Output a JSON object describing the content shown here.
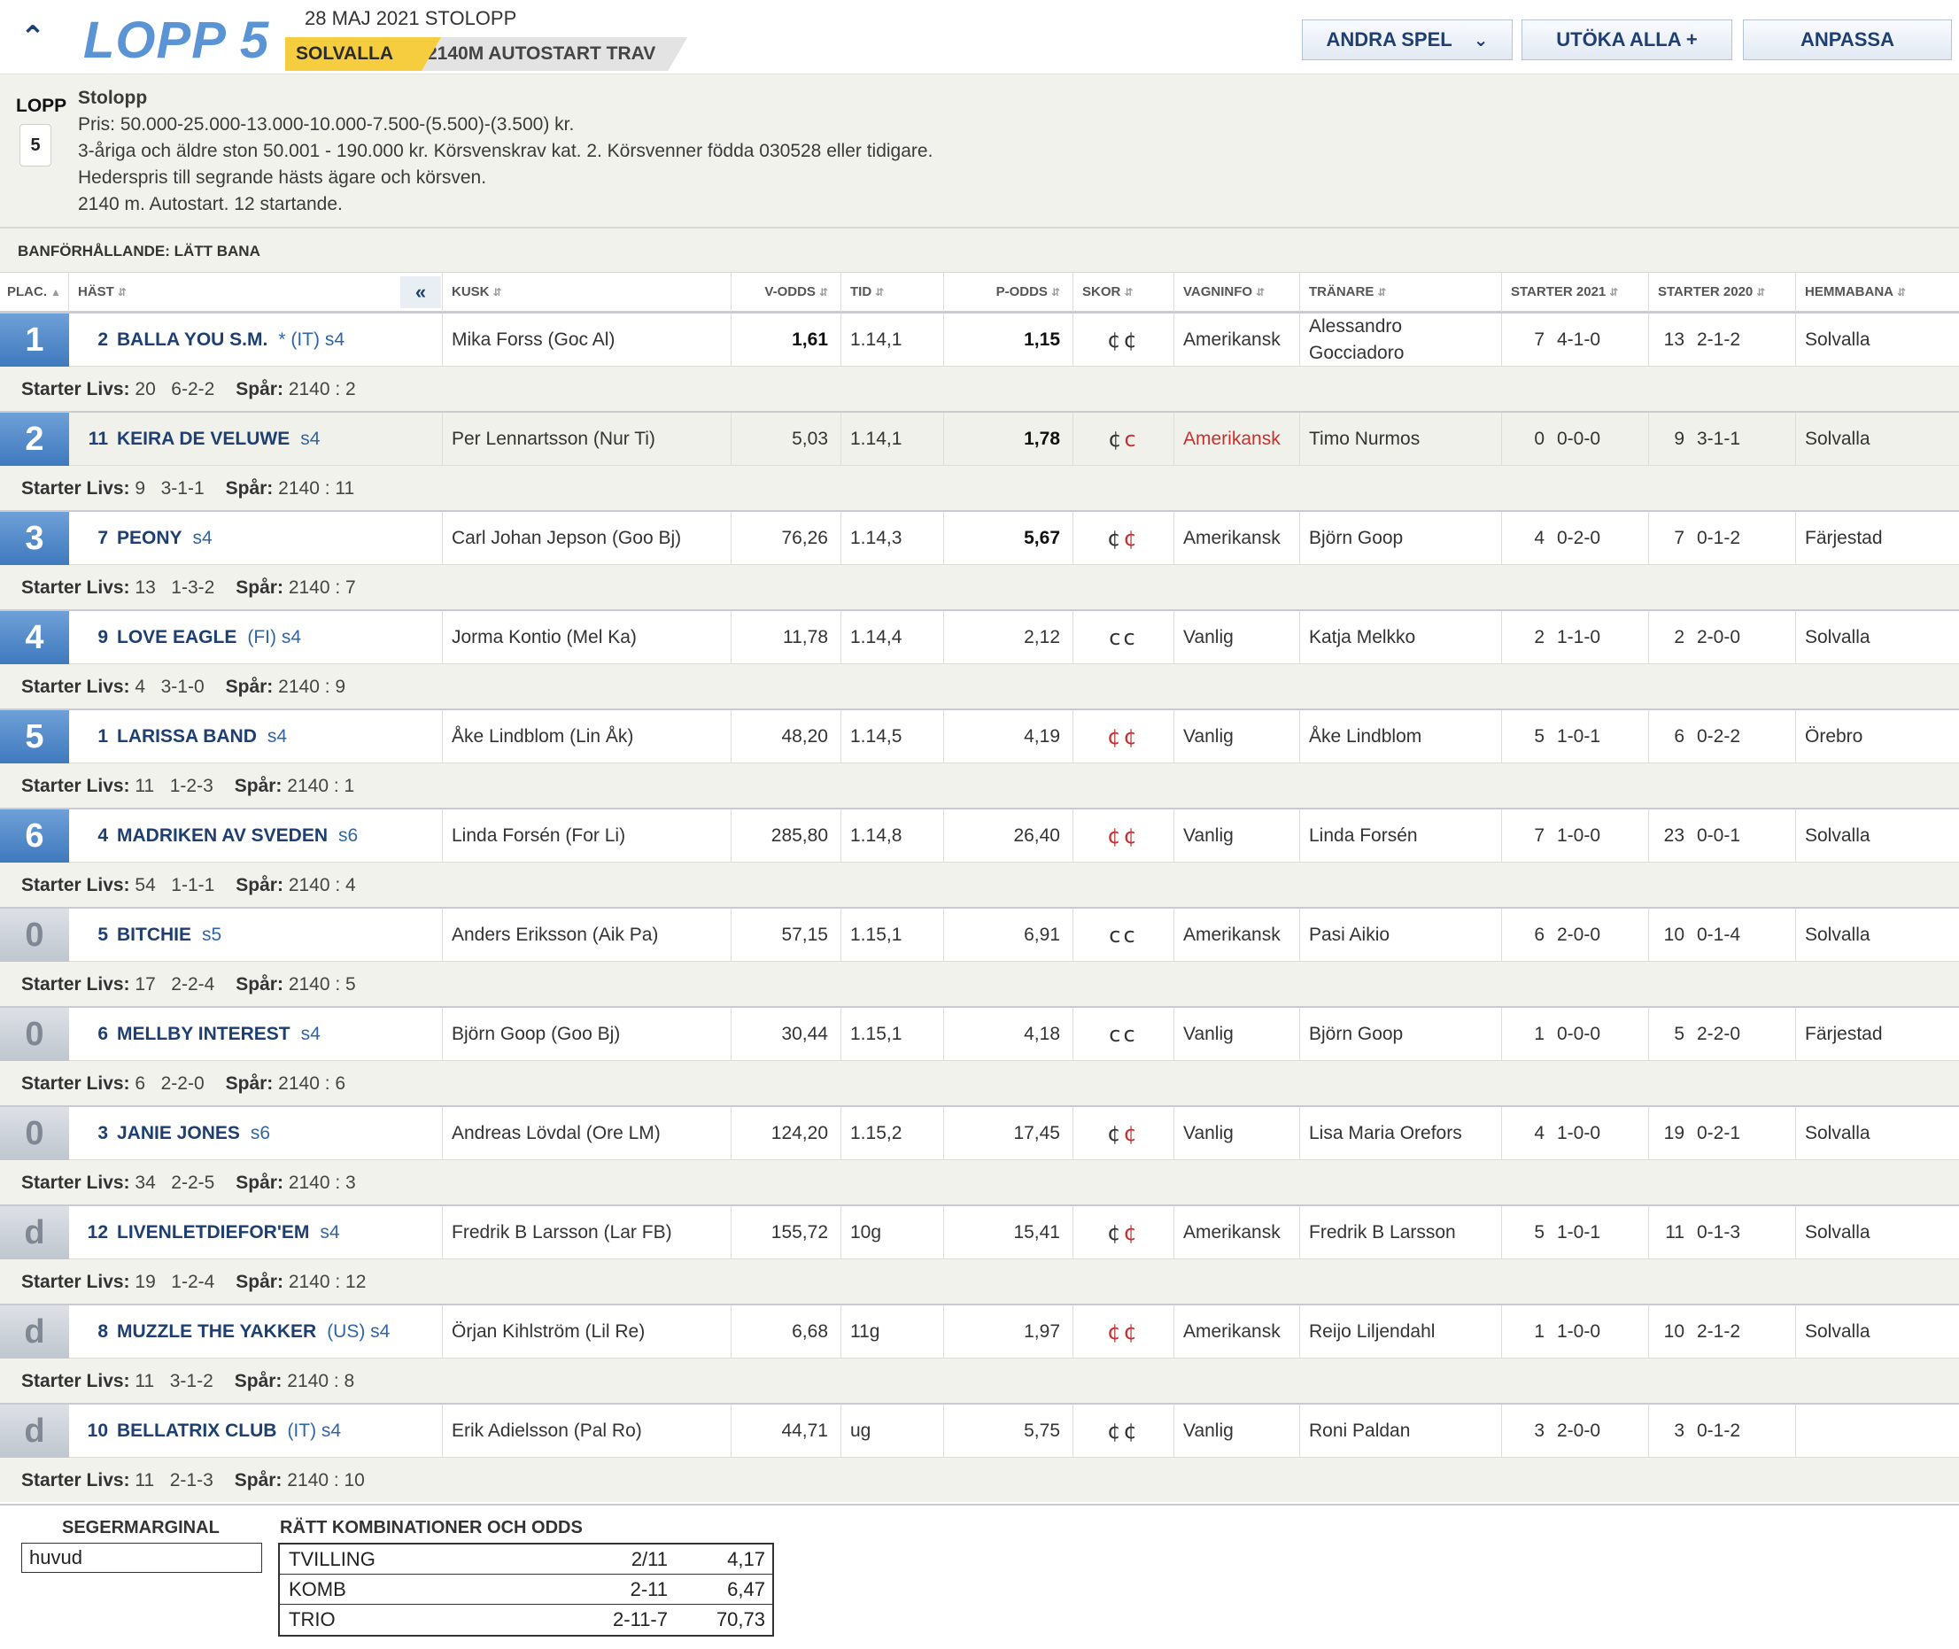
{
  "header": {
    "race_title": "LOPP 5",
    "date_line": "28 MAJ 2021 STOLOPP",
    "track": "SOLVALLA",
    "race_type": "2140M AUTOSTART TRAV",
    "buttons": {
      "andra_spel": "ANDRA SPEL",
      "utoka_alla": "UTÖKA ALLA +",
      "anpassa": "ANPASSA"
    }
  },
  "info": {
    "lopp_label": "LOPP",
    "lopp_number": "5",
    "title": "Stolopp",
    "lines": [
      "Pris: 50.000-25.000-13.000-10.000-7.500-(5.500)-(3.500) kr.",
      "3-åriga och äldre ston 50.001 - 190.000 kr. Körsvenskrav kat. 2. Körsvenner födda 030528 eller tidigare.",
      "Hederspris till segrande hästs ägare och körsven.",
      "2140 m. Autostart. 12 startande."
    ]
  },
  "track_condition": "BANFÖRHÅLLANDE: LÄTT BANA",
  "columns": {
    "plac": "PLAC.",
    "hast": "HÄST",
    "kusk": "KUSK",
    "v_odds": "V-ODDS",
    "tid": "TID",
    "p_odds": "P-ODDS",
    "skor": "SKOR",
    "vagninfo": "VAGNINFO",
    "tranare": "TRÄNARE",
    "starter_2021": "STARTER 2021",
    "starter_2020": "STARTER 2020",
    "hemmabana": "HEMMABANA"
  },
  "labels": {
    "starter_livs": "Starter Livs:",
    "spar": "Spår:"
  },
  "rows": [
    {
      "place": "1",
      "num": "2",
      "name": "BALLA YOU S.M.",
      "suffix": "* (IT)  s4",
      "driver": "Mika Forss (Goc Al)",
      "v_odds": "1,61",
      "tid": "1.14,1",
      "p_odds": "1,15",
      "shoe1": "¢",
      "shoe2": "¢",
      "wagon": "Amerikansk",
      "trainer": "Alessandro Gocciadoro",
      "s21n": "7",
      "s21r": "4-1-0",
      "s20n": "13",
      "s20r": "2-1-2",
      "home": "Solvalla",
      "livs_n": "20",
      "livs_r": "6-2-2",
      "spar": "2140 : 2"
    },
    {
      "place": "2",
      "num": "11",
      "name": "KEIRA DE VELUWE",
      "suffix": "s4",
      "driver": "Per Lennartsson (Nur Ti)",
      "v_odds": "5,03",
      "tid": "1.14,1",
      "p_odds": "1,78",
      "shoe1": "¢",
      "shoe2": "c",
      "wagon": "Amerikansk",
      "trainer": "Timo Nurmos",
      "s21n": "0",
      "s21r": "0-0-0",
      "s20n": "9",
      "s20r": "3-1-1",
      "home": "Solvalla",
      "livs_n": "9",
      "livs_r": "3-1-1",
      "spar": "2140 : 11"
    },
    {
      "place": "3",
      "num": "7",
      "name": "PEONY",
      "suffix": "s4",
      "driver": "Carl Johan Jepson (Goo Bj)",
      "v_odds": "76,26",
      "tid": "1.14,3",
      "p_odds": "5,67",
      "shoe1": "¢",
      "shoe2": "¢",
      "wagon": "Amerikansk",
      "trainer": "Björn Goop",
      "s21n": "4",
      "s21r": "0-2-0",
      "s20n": "7",
      "s20r": "0-1-2",
      "home": "Färjestad",
      "livs_n": "13",
      "livs_r": "1-3-2",
      "spar": "2140 : 7"
    },
    {
      "place": "4",
      "num": "9",
      "name": "LOVE EAGLE",
      "suffix": "(FI)  s4",
      "driver": "Jorma Kontio (Mel Ka)",
      "v_odds": "11,78",
      "tid": "1.14,4",
      "p_odds": "2,12",
      "shoe1": "c",
      "shoe2": "c",
      "wagon": "Vanlig",
      "trainer": "Katja Melkko",
      "s21n": "2",
      "s21r": "1-1-0",
      "s20n": "2",
      "s20r": "2-0-0",
      "home": "Solvalla",
      "livs_n": "4",
      "livs_r": "3-1-0",
      "spar": "2140 : 9"
    },
    {
      "place": "5",
      "num": "1",
      "name": "LARISSA BAND",
      "suffix": "s4",
      "driver": "Åke Lindblom (Lin Åk)",
      "v_odds": "48,20",
      "tid": "1.14,5",
      "p_odds": "4,19",
      "shoe1": "¢",
      "shoe2": "¢",
      "wagon": "Vanlig",
      "trainer": "Åke Lindblom",
      "s21n": "5",
      "s21r": "1-0-1",
      "s20n": "6",
      "s20r": "0-2-2",
      "home": "Örebro",
      "livs_n": "11",
      "livs_r": "1-2-3",
      "spar": "2140 : 1"
    },
    {
      "place": "6",
      "num": "4",
      "name": "MADRIKEN AV SVEDEN",
      "suffix": "s6",
      "driver": "Linda Forsén (For Li)",
      "v_odds": "285,80",
      "tid": "1.14,8",
      "p_odds": "26,40",
      "shoe1": "¢",
      "shoe2": "¢",
      "wagon": "Vanlig",
      "trainer": "Linda Forsén",
      "s21n": "7",
      "s21r": "1-0-0",
      "s20n": "23",
      "s20r": "0-0-1",
      "home": "Solvalla",
      "livs_n": "54",
      "livs_r": "1-1-1",
      "spar": "2140 : 4"
    },
    {
      "place": "0",
      "num": "5",
      "name": "BITCHIE",
      "suffix": "s5",
      "driver": "Anders Eriksson (Aik Pa)",
      "v_odds": "57,15",
      "tid": "1.15,1",
      "p_odds": "6,91",
      "shoe1": "c",
      "shoe2": "c",
      "wagon": "Amerikansk",
      "trainer": "Pasi Aikio",
      "s21n": "6",
      "s21r": "2-0-0",
      "s20n": "10",
      "s20r": "0-1-4",
      "home": "Solvalla",
      "livs_n": "17",
      "livs_r": "2-2-4",
      "spar": "2140 : 5"
    },
    {
      "place": "0",
      "num": "6",
      "name": "MELLBY INTEREST",
      "suffix": "s4",
      "driver": "Björn Goop (Goo Bj)",
      "v_odds": "30,44",
      "tid": "1.15,1",
      "p_odds": "4,18",
      "shoe1": "c",
      "shoe2": "c",
      "wagon": "Vanlig",
      "trainer": "Björn Goop",
      "s21n": "1",
      "s21r": "0-0-0",
      "s20n": "5",
      "s20r": "2-2-0",
      "home": "Färjestad",
      "livs_n": "6",
      "livs_r": "2-2-0",
      "spar": "2140 : 6"
    },
    {
      "place": "0",
      "num": "3",
      "name": "JANIE JONES",
      "suffix": "s6",
      "driver": "Andreas Lövdal (Ore LM)",
      "v_odds": "124,20",
      "tid": "1.15,2",
      "p_odds": "17,45",
      "shoe1": "¢",
      "shoe2": "¢",
      "wagon": "Vanlig",
      "trainer": "Lisa Maria Orefors",
      "s21n": "4",
      "s21r": "1-0-0",
      "s20n": "19",
      "s20r": "0-2-1",
      "home": "Solvalla",
      "livs_n": "34",
      "livs_r": "2-2-5",
      "spar": "2140 : 3"
    },
    {
      "place": "d",
      "num": "12",
      "name": "LIVENLETDIEFOR'EM",
      "suffix": "s4",
      "driver": "Fredrik B Larsson (Lar FB)",
      "v_odds": "155,72",
      "tid": "10g",
      "p_odds": "15,41",
      "shoe1": "¢",
      "shoe2": "¢",
      "wagon": "Amerikansk",
      "trainer": "Fredrik B Larsson",
      "s21n": "5",
      "s21r": "1-0-1",
      "s20n": "11",
      "s20r": "0-1-3",
      "home": "Solvalla",
      "livs_n": "19",
      "livs_r": "1-2-4",
      "spar": "2140 : 12"
    },
    {
      "place": "d",
      "num": "8",
      "name": "MUZZLE THE YAKKER",
      "suffix": "(US)  s4",
      "driver": "Örjan Kihlström (Lil Re)",
      "v_odds": "6,68",
      "tid": "11g",
      "p_odds": "1,97",
      "shoe1": "¢",
      "shoe2": "¢",
      "wagon": "Amerikansk",
      "trainer": "Reijo Liljendahl",
      "s21n": "1",
      "s21r": "1-0-0",
      "s20n": "10",
      "s20r": "2-1-2",
      "home": "Solvalla",
      "livs_n": "11",
      "livs_r": "3-1-2",
      "spar": "2140 : 8"
    },
    {
      "place": "d",
      "num": "10",
      "name": "BELLATRIX CLUB",
      "suffix": "(IT)  s4",
      "driver": "Erik Adielsson (Pal Ro)",
      "v_odds": "44,71",
      "tid": "ug",
      "p_odds": "5,75",
      "shoe1": "¢",
      "shoe2": "¢",
      "wagon": "Vanlig",
      "trainer": "Roni Paldan",
      "s21n": "3",
      "s21r": "2-0-0",
      "s20n": "3",
      "s20r": "0-1-2",
      "home": "",
      "livs_n": "11",
      "livs_r": "2-1-3",
      "spar": "2140 : 10"
    }
  ],
  "footer": {
    "segermarginal_label": "SEGERMARGINAL",
    "segermarginal_value": "huvud",
    "kombinationer_label": "RÄTT KOMBINATIONER OCH ODDS",
    "combos": [
      {
        "name": "TVILLING",
        "combo": "2/11",
        "odds": "4,17"
      },
      {
        "name": "KOMB",
        "combo": "2-11",
        "odds": "6,47"
      },
      {
        "name": "TRIO",
        "combo": "2-11-7",
        "odds": "70,73"
      }
    ]
  },
  "colors": {
    "accent": "#5b94d4",
    "navy": "#1d3f72",
    "yellow": "#f6cd3e",
    "red": "#c8302f"
  },
  "styling": {
    "bold_v_odds_rows": [
      0
    ],
    "bold_p_odds_rows": [
      0,
      1,
      2
    ],
    "red_wagon_rows": [
      1
    ],
    "red_shoe": {
      "0": [
        false,
        false
      ],
      "1": [
        false,
        true
      ],
      "2": [
        false,
        true
      ],
      "3": [
        false,
        false
      ],
      "4": [
        true,
        true
      ],
      "5": [
        true,
        true
      ],
      "6": [
        false,
        false
      ],
      "7": [
        false,
        false
      ],
      "8": [
        false,
        true
      ],
      "9": [
        false,
        true
      ],
      "10": [
        true,
        true
      ],
      "11": [
        false,
        false
      ]
    }
  },
  "icons": {
    "collapse": "double-chevron-up-icon",
    "dropdown": "chevron-down-icon",
    "collapse_col": "double-chevron-left-icon",
    "sort": "sort-arrows-icon"
  }
}
